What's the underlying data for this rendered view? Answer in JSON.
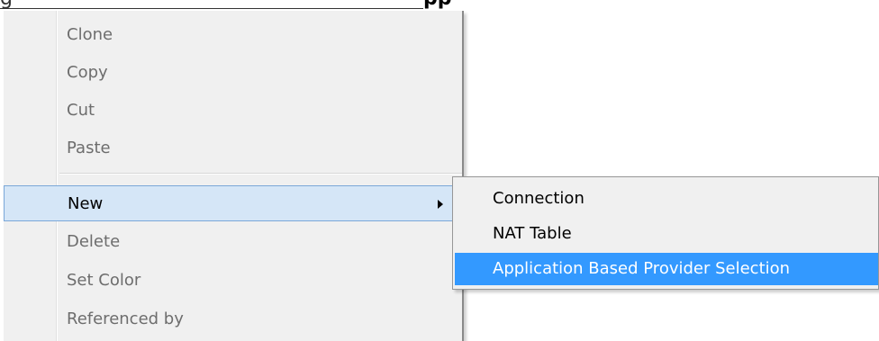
{
  "background_heading": {
    "left_text": "g",
    "bold_text": "pp"
  },
  "context_menu": {
    "items": [
      {
        "label": "Clone",
        "enabled": false
      },
      {
        "label": "Copy",
        "enabled": false
      },
      {
        "label": "Cut",
        "enabled": false
      },
      {
        "label": "Paste",
        "enabled": false
      },
      {
        "label": "New",
        "enabled": true,
        "has_submenu": true,
        "highlighted": true
      },
      {
        "label": "Delete",
        "enabled": false
      },
      {
        "label": "Set Color",
        "enabled": false
      },
      {
        "label": "Referenced by",
        "enabled": false
      }
    ]
  },
  "submenu": {
    "items": [
      {
        "label": "Connection"
      },
      {
        "label": "NAT Table"
      },
      {
        "label": "Application Based Provider Selection",
        "selected": true
      }
    ]
  },
  "colors": {
    "menu_background": "#f0f0f0",
    "highlight_background": "#d5e6f7",
    "highlight_border": "#7aa7d8",
    "selected_background": "#3399ff",
    "disabled_text": "#6d6d6d"
  }
}
